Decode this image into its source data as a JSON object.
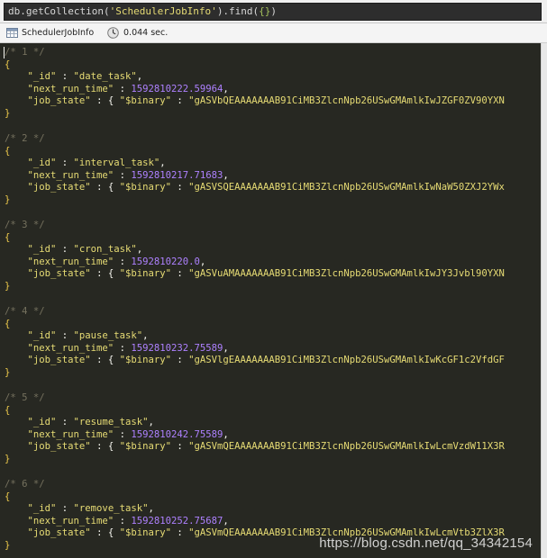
{
  "query": {
    "prefix": "db.getCollection(",
    "collection": "'SchedulerJobInfo'",
    "middle": ").find(",
    "arg": "{}",
    "suffix": ")"
  },
  "tab": {
    "collection_name": "SchedulerJobInfo",
    "exec_time": "0.044 sec.",
    "collection_icon": "table-icon",
    "time_icon": "clock-icon"
  },
  "field_keys": {
    "id": "\"_id\"",
    "next_run_time": "\"next_run_time\"",
    "job_state": "\"job_state\"",
    "binary": "\"$binary\""
  },
  "records": [
    {
      "comment": "/* 1 */",
      "id": "\"date_task\"",
      "next_run_time": "1592810222.59964",
      "job_state": "\"gASVbQEAAAAAAAB91CiMB3ZlcnNpb26USwGMAmlkIwJZGF0ZV90YXN"
    },
    {
      "comment": "/* 2 */",
      "id": "\"interval_task\"",
      "next_run_time": "1592810217.71683",
      "job_state": "\"gASVSQEAAAAAAAB91CiMB3ZlcnNpb26USwGMAmlkIwNaW50ZXJ2YWx"
    },
    {
      "comment": "/* 3 */",
      "id": "\"cron_task\"",
      "next_run_time": "1592810220.0",
      "job_state": "\"gASVuAMAAAAAAAB91CiMB3ZlcnNpb26USwGMAmlkIwJY3Jvbl90YXN"
    },
    {
      "comment": "/* 4 */",
      "id": "\"pause_task\"",
      "next_run_time": "1592810232.75589",
      "job_state": "\"gASVlgEAAAAAAAB91CiMB3ZlcnNpb26USwGMAmlkIwKcGF1c2VfdGF"
    },
    {
      "comment": "/* 5 */",
      "id": "\"resume_task\"",
      "next_run_time": "1592810242.75589",
      "job_state": "\"gASVmQEAAAAAAAB91CiMB3ZlcnNpb26USwGMAmlkIwLcmVzdW11X3R"
    },
    {
      "comment": "/* 6 */",
      "id": "\"remove_task\"",
      "next_run_time": "1592810252.75687",
      "job_state": "\"gASVmQEAAAAAAAB91CiMB3ZlcnNpb26USwGMAmlkIwLcmVtb3ZlX3R"
    }
  ],
  "watermark": "https://blog.csdn.net/qq_34342154",
  "colors": {
    "editor_bg": "#272822",
    "comment": "#75715e",
    "string": "#e6db74",
    "number": "#ae81ff",
    "brace": "#ecc94b"
  }
}
